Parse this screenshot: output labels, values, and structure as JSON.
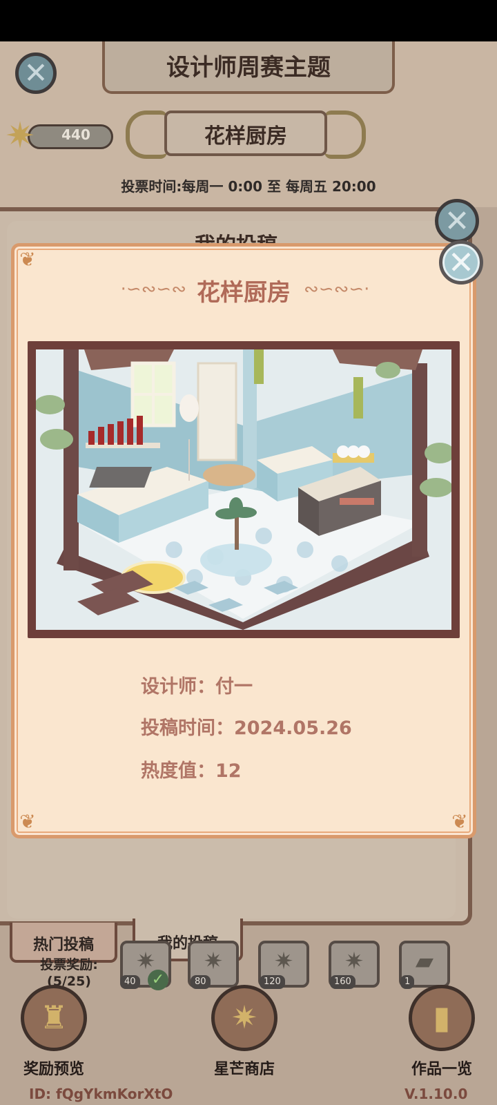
{
  "header": {
    "title": "设计师周赛主题",
    "theme": "花样厨房",
    "vote_time": "投票时间:每周一  0:00  至  每周五  20:00"
  },
  "currency": {
    "stars": "440"
  },
  "under_panel": {
    "title": "我的投稿"
  },
  "popup": {
    "title": "花样厨房",
    "designer_label": "设计师：",
    "designer_value": "付一",
    "time_label": "投稿时间：",
    "time_value": "2024.05.26",
    "heat_label": "热度值：",
    "heat_value": "12"
  },
  "tabs": {
    "hot": "热门投稿",
    "mine": "我的投稿"
  },
  "vote_rewards": {
    "label_line1": "投票奖励:",
    "label_line2": "(5/25)",
    "items": [
      "40",
      "80",
      "120",
      "160",
      "1"
    ]
  },
  "bottom_nav": {
    "rewards": "奖励预览",
    "shop": "星芒商店",
    "works": "作品一览"
  },
  "footer": {
    "user_id": "ID:  fQgYkmKorXtO",
    "version": "V.1.10.0"
  },
  "icons": {
    "close": "close-icon",
    "star": "star-icon",
    "check": "check-icon",
    "trophy": "trophy-icon",
    "book": "book-icon"
  },
  "colors": {
    "popup_bg": "#fae6cf",
    "popup_border": "#d99a6c",
    "title_color": "#b06a58",
    "info_text": "#b07566",
    "frame": "#6e3f3a"
  }
}
